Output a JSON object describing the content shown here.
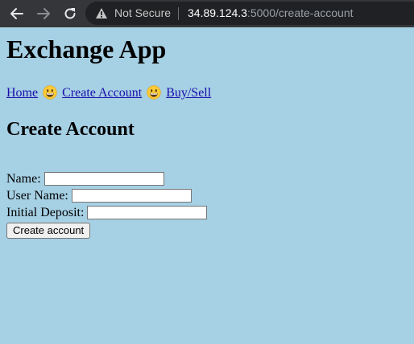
{
  "browser": {
    "security_label": "Not Secure",
    "url_host": "34.89.124.3",
    "url_rest": ":5000/create-account",
    "icons": {
      "back": "arrow-left-icon",
      "forward": "arrow-right-icon",
      "reload": "reload-icon",
      "security": "warning-triangle-icon"
    }
  },
  "page": {
    "title": "Exchange App",
    "nav": {
      "items": [
        {
          "label": "Home"
        },
        {
          "label": "Create Account"
        },
        {
          "label": "Buy/Sell"
        }
      ],
      "separator_icon": "grinning-face-emoji"
    },
    "form": {
      "heading": "Create Account",
      "fields": [
        {
          "label": "Name:",
          "value": ""
        },
        {
          "label": "User Name:",
          "value": ""
        },
        {
          "label": "Initial Deposit:",
          "value": ""
        }
      ],
      "submit_label": "Create account"
    }
  },
  "colors": {
    "page_background": "#a6d0e4",
    "browser_chrome": "#35363a",
    "link": "#1a0dab"
  }
}
